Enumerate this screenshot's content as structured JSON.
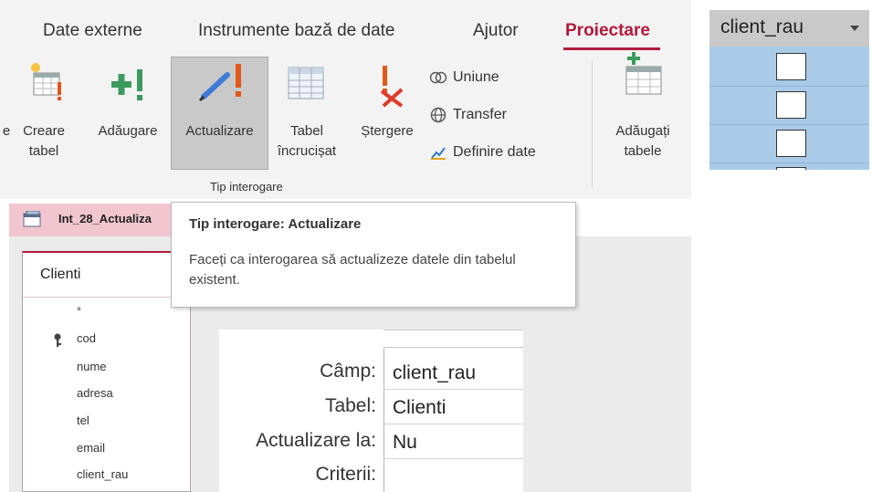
{
  "ribbon": {
    "tabs": [
      {
        "label": "Date externe"
      },
      {
        "label": "Instrumente bază de date"
      },
      {
        "label": "Ajutor"
      },
      {
        "label": "Proiectare",
        "active": true
      }
    ],
    "buttons": {
      "cut_prefix": "e",
      "create_table": [
        "Creare",
        "tabel"
      ],
      "append": [
        "Adăugare"
      ],
      "update": [
        "Actualizare"
      ],
      "crosstab": [
        "Tabel",
        "încrucișat"
      ],
      "delete": [
        "Ștergere"
      ],
      "add_tables": [
        "Adăugați",
        "tabele"
      ]
    },
    "small_commands": {
      "union": "Uniune",
      "passthrough": "Transfer",
      "data_definition": "Definire date"
    },
    "group_label": "Tip interogare"
  },
  "tooltip": {
    "title": "Tip interogare: Actualizare",
    "body": "Faceți ca interogarea să actualizeze datele din tabelul existent."
  },
  "document_tab": {
    "title": "Int_28_Actualiza"
  },
  "field_list": {
    "table_name": "Clienti",
    "all_fields": "*",
    "fields": [
      "cod",
      "nume",
      "adresa",
      "tel",
      "email",
      "client_rau"
    ]
  },
  "qbe_grid": {
    "rows": [
      {
        "label": "Câmp:",
        "value": "client_rau"
      },
      {
        "label": "Tabel:",
        "value": "Clienti"
      },
      {
        "label": "Actualizare la:",
        "value": "Nu"
      },
      {
        "label": "Criterii:",
        "value": ""
      }
    ]
  },
  "datasheet": {
    "column_header": "client_rau",
    "checkbox_values": [
      false,
      false,
      false
    ]
  },
  "colors": {
    "accent": "#b11a3c",
    "ribbon_bg": "#f3f3f3",
    "selected_button": "#c9c9c9",
    "datasheet_row": "#a9cbe8",
    "doc_tab": "#f2c6cf"
  }
}
